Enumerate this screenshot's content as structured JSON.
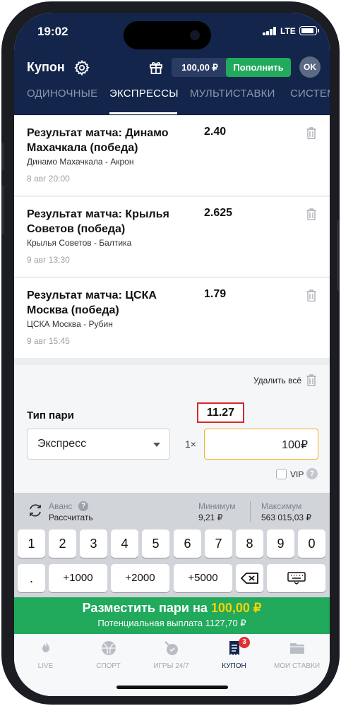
{
  "status_bar": {
    "time": "19:02",
    "network": "LTE"
  },
  "header": {
    "title": "Купон",
    "balance": "100,00 ₽",
    "topup_label": "Пополнить",
    "avatar_initials": "OK"
  },
  "tabs": [
    {
      "label": "ОДИНОЧНЫЕ",
      "active": false
    },
    {
      "label": "ЭКСПРЕССЫ",
      "active": true
    },
    {
      "label": "МУЛЬТИСТАВКИ",
      "active": false
    },
    {
      "label": "СИСТЕМ",
      "active": false
    }
  ],
  "bets": [
    {
      "title": "Результат матча: Динамо Махачкала (победа)",
      "odd": "2.40",
      "teams": "Динамо Махачкала - Акрон",
      "date": "8 авг 20:00"
    },
    {
      "title": "Результат матча: Крылья Советов (победа)",
      "odd": "2.625",
      "teams": "Крылья Советов - Балтика",
      "date": "9 авг 13:30"
    },
    {
      "title": "Результат матча: ЦСКА Москва (победа)",
      "odd": "1.79",
      "teams": "ЦСКА Москва - Рубин",
      "date": "9 авг 15:45"
    }
  ],
  "delete_all_label": "Удалить всё",
  "bet_panel": {
    "type_label": "Тип пари",
    "total_odd": "11.27",
    "bet_type": "Экспресс",
    "multiplier": "1×",
    "stake": "100₽",
    "vip_label": "VIP",
    "vip_checked": false
  },
  "keyboard_info": {
    "advance_label": "Аванс",
    "calculate_label": "Рассчитать",
    "min_label": "Минимум",
    "min_value": "9,21 ₽",
    "max_label": "Максимум",
    "max_value": "563 015,03 ₽"
  },
  "keys": {
    "digits": [
      "1",
      "2",
      "3",
      "4",
      "5",
      "6",
      "7",
      "8",
      "9",
      "0"
    ],
    "decimal": ".",
    "quick": [
      "+1000",
      "+2000",
      "+5000"
    ]
  },
  "place_bet": {
    "prefix": "Разместить пари на ",
    "amount": "100,00 ₽",
    "payout": "Потенциальная выплата 1127,70 ₽"
  },
  "nav": [
    {
      "label": "LIVE",
      "icon": "fire-icon",
      "active": false
    },
    {
      "label": "СПОРТ",
      "icon": "ball-icon",
      "active": false
    },
    {
      "label": "ИГРЫ 24/7",
      "icon": "games-icon",
      "active": false
    },
    {
      "label": "КУПОН",
      "icon": "coupon-icon",
      "active": true,
      "badge": "3"
    },
    {
      "label": "МОИ СТАВКИ",
      "icon": "folder-icon",
      "active": false
    }
  ],
  "colors": {
    "header_bg": "#13254a",
    "accent_green": "#21a95c",
    "highlight_red": "#d9262c",
    "amount_yellow": "#ffd200",
    "stake_border": "#f0b229"
  }
}
